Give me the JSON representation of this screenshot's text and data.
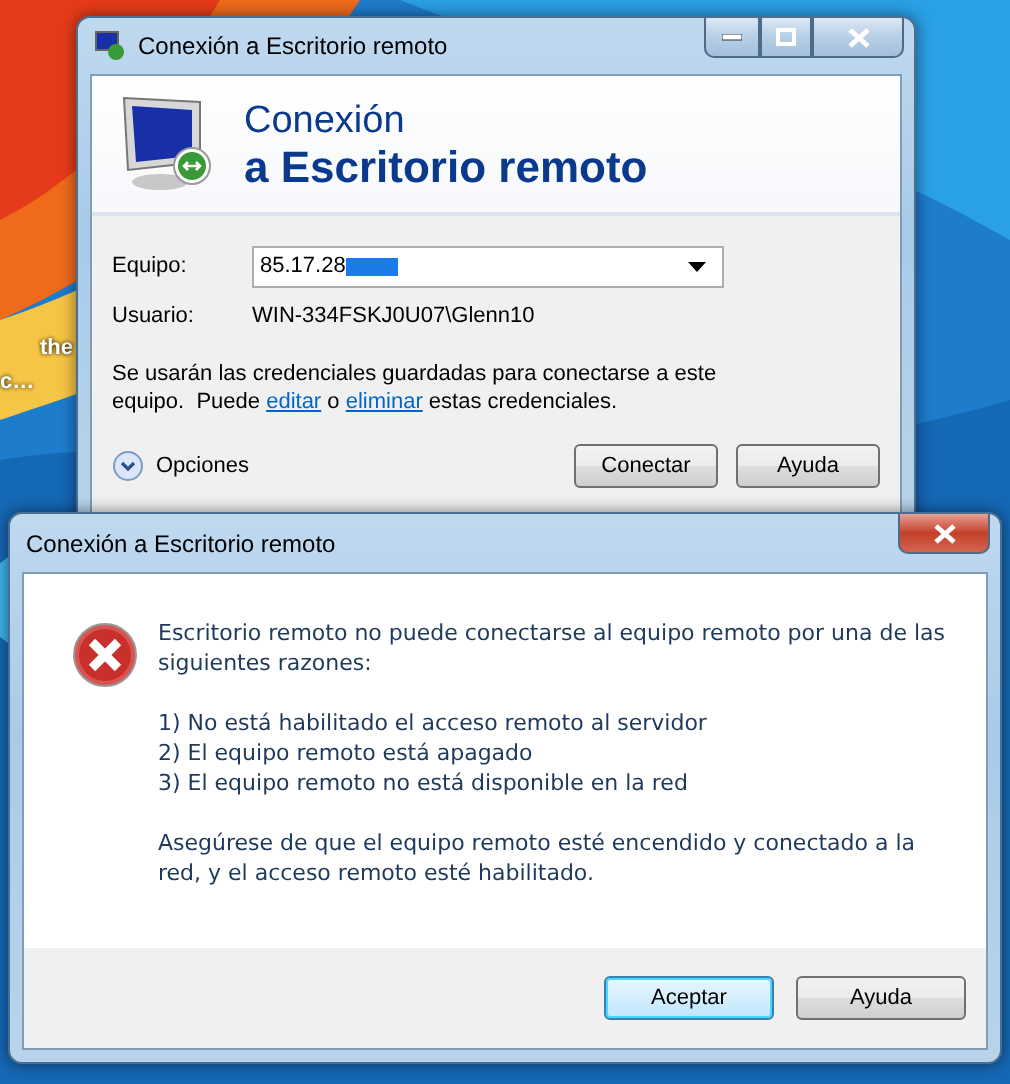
{
  "desktop_labels": [
    "the",
    "c…"
  ],
  "main_window": {
    "title": "Conexión a Escritorio remoto",
    "header": {
      "line_1": "Conexión",
      "line_2": "a Escritorio remoto"
    },
    "computer": {
      "label": "Equipo:",
      "value": "85.17.28"
    },
    "user": {
      "label": "Usuario:",
      "value": "WIN-334FSKJ0U07\\Glenn10"
    },
    "credentials_note": [
      {
        "kind": "text",
        "text": "Se usarán las credenciales guardadas para conectarse a este equipo.  Puede "
      },
      {
        "kind": "link",
        "text": "editar"
      },
      {
        "kind": "text",
        "text": " o "
      },
      {
        "kind": "link",
        "text": "eliminar"
      },
      {
        "kind": "text",
        "text": " estas credenciales."
      }
    ],
    "options_label": "Opciones",
    "buttons": [
      "Conectar",
      "Ayuda"
    ]
  },
  "error_dialog": {
    "title": "Conexión a Escritorio remoto",
    "message": "Escritorio remoto no puede conectarse al equipo remoto por una de las siguientes razones:",
    "reasons": [
      "1) No está habilitado el acceso remoto al servidor",
      "2) El equipo remoto está apagado",
      "3) El equipo remoto no está disponible en la red"
    ],
    "advice": "Asegúrese de que el equipo remoto esté encendido y conectado a la red, y el acceso remoto esté habilitado.",
    "buttons": [
      {
        "label": "Aceptar",
        "default": true
      },
      {
        "label": "Ayuda",
        "default": false
      }
    ]
  }
}
